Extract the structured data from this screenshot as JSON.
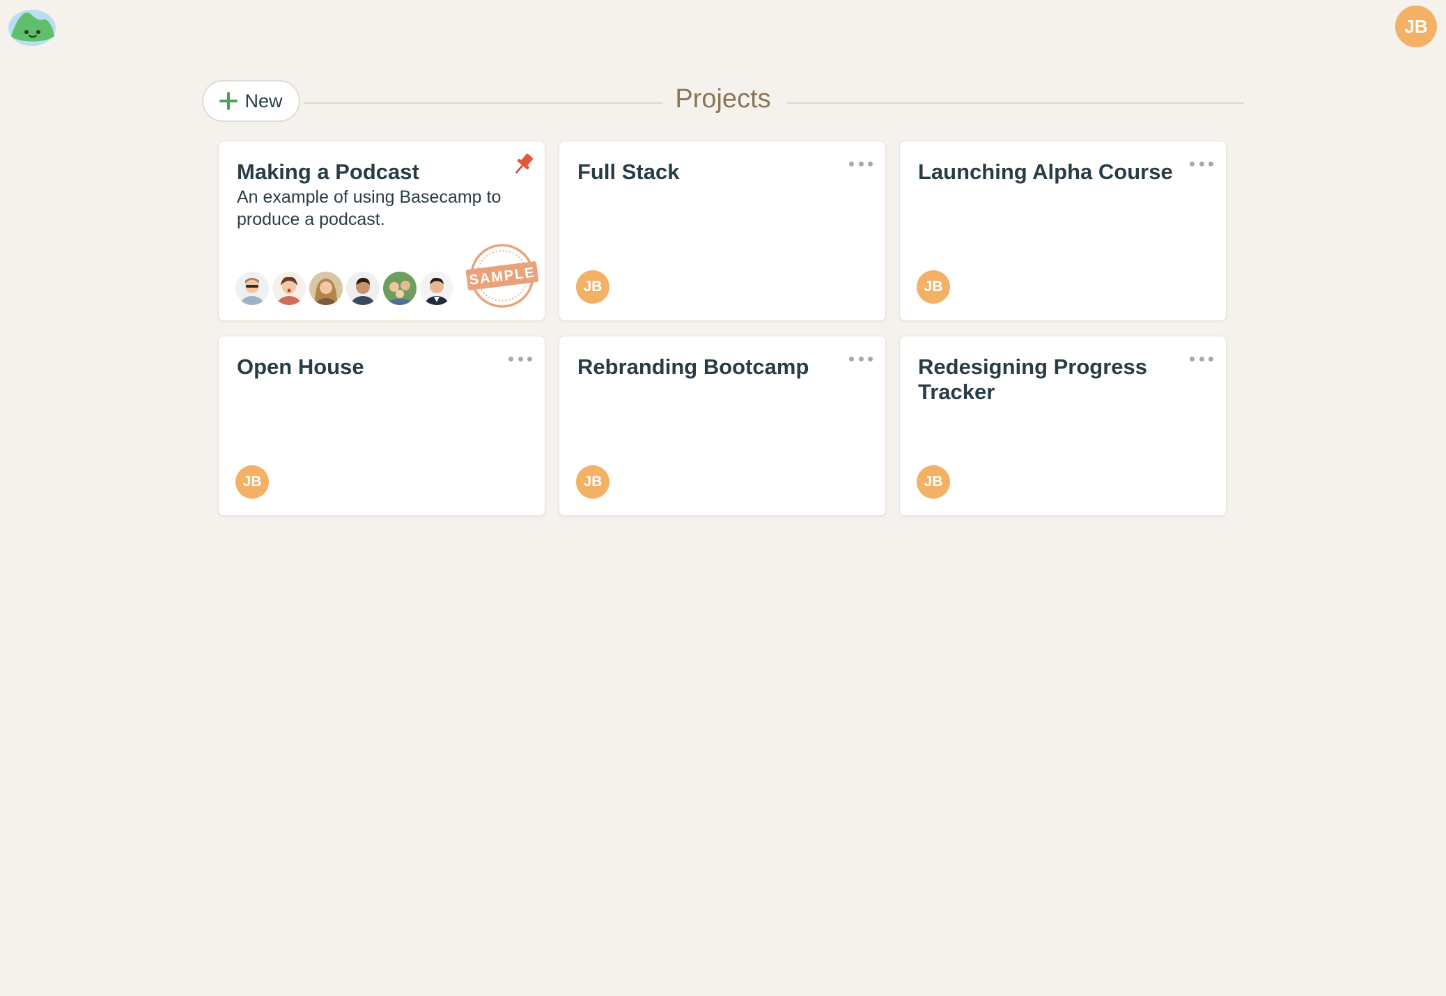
{
  "app": {
    "logo": "basecamp-logo-icon",
    "user_initials": "JB"
  },
  "header": {
    "new_label": "New",
    "title": "Projects"
  },
  "projects": [
    {
      "name": "Making a Podcast",
      "description": "An example of using Basecamp to produce a podcast.",
      "pinned": true,
      "badge": "SAMPLE",
      "people": [
        "person-1",
        "person-2",
        "person-3",
        "person-4",
        "person-5",
        "person-6"
      ]
    },
    {
      "name": "Full Stack",
      "member_initials": "JB"
    },
    {
      "name": "Launching Alpha Course",
      "member_initials": "JB"
    },
    {
      "name": "Open House",
      "member_initials": "JB"
    },
    {
      "name": "Rebranding Bootcamp",
      "member_initials": "JB"
    },
    {
      "name": "Redesigning Progress Tracker",
      "member_initials": "JB"
    }
  ],
  "colors": {
    "background": "#f5f2ee",
    "avatar": "#f2b165",
    "title_text": "#283c46",
    "heading_text": "#8a7656",
    "accent_green": "#4aa35b",
    "pin": "#e2583e",
    "stamp": "#e9a27a"
  }
}
